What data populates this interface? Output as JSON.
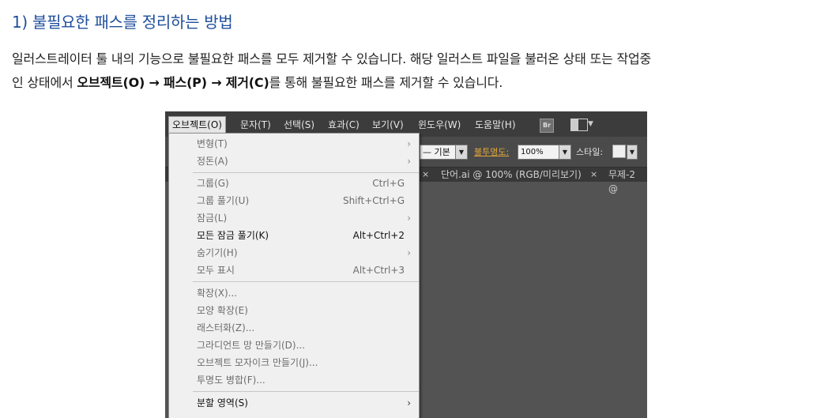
{
  "heading": "1) 불필요한 패스를 정리하는 방법",
  "paragraph": {
    "line1": "일러스트레이터 툴 내의 기능으로 불필요한 패스를 모두 제거할 수 있습니다. 해당 일러스트 파일을 불러온 상태 또는 작업중",
    "line2_prefix": "인 상태에서 ",
    "path_bold_1": "오브젝트(O) → 패스(P) → 제거(C)",
    "line2_suffix": "를 통해 불필요한 패스를 제거할 수 있습니다."
  },
  "screenshot": {
    "menubar": {
      "items": [
        "오브젝트(O)",
        "문자(T)",
        "선택(S)",
        "효과(C)",
        "보기(V)",
        "윈도우(W)",
        "도움말(H)"
      ],
      "bridge_icon": "Br"
    },
    "control_bar": {
      "stroke_style": "기본",
      "opacity_label": "불투명도:",
      "opacity_value": "100%",
      "style_label": "스타일:"
    },
    "tabs": {
      "doc1": "단어.ai @ 100% (RGB/미리보기)",
      "doc2": "무제-2 @",
      "close": "×"
    },
    "dropdown": {
      "items": [
        {
          "label": "변형(T)",
          "shortcut": "",
          "submenu": true,
          "enabled": false
        },
        {
          "label": "정돈(A)",
          "shortcut": "",
          "submenu": true,
          "enabled": false
        },
        {
          "label": "그룹(G)",
          "shortcut": "Ctrl+G",
          "submenu": false,
          "enabled": false
        },
        {
          "label": "그룹 풀기(U)",
          "shortcut": "Shift+Ctrl+G",
          "submenu": false,
          "enabled": false
        },
        {
          "label": "잠금(L)",
          "shortcut": "",
          "submenu": true,
          "enabled": false
        },
        {
          "label": "모든 잠금 풀기(K)",
          "shortcut": "Alt+Ctrl+2",
          "submenu": false,
          "enabled": true
        },
        {
          "label": "숨기기(H)",
          "shortcut": "",
          "submenu": true,
          "enabled": false
        },
        {
          "label": "모두 표시",
          "shortcut": "Alt+Ctrl+3",
          "submenu": false,
          "enabled": false
        },
        {
          "label": "확장(X)...",
          "shortcut": "",
          "submenu": false,
          "enabled": false
        },
        {
          "label": "모양 확장(E)",
          "shortcut": "",
          "submenu": false,
          "enabled": false
        },
        {
          "label": "래스터화(Z)...",
          "shortcut": "",
          "submenu": false,
          "enabled": false
        },
        {
          "label": "그라디언트 망 만들기(D)...",
          "shortcut": "",
          "submenu": false,
          "enabled": false
        },
        {
          "label": "오브젝트 모자이크 만들기(J)...",
          "shortcut": "",
          "submenu": false,
          "enabled": false
        },
        {
          "label": "투명도 병합(F)...",
          "shortcut": "",
          "submenu": false,
          "enabled": false
        },
        {
          "label": "분할 영역(S)",
          "shortcut": "",
          "submenu": true,
          "enabled": true
        }
      ]
    }
  },
  "colors": {
    "heading": "#1f4e9c",
    "opacity_label": "#e0a53a",
    "app_background": "#535353",
    "menu_background": "#f0f0f0"
  }
}
